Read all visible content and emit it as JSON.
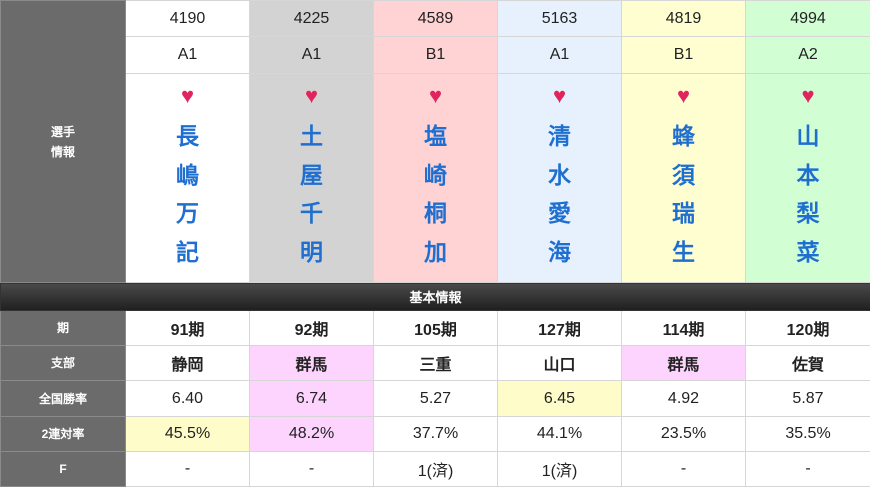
{
  "racers": [
    {
      "number": "4190",
      "grade": "A1",
      "name_chars": [
        "長",
        "嶋",
        "万",
        "記"
      ],
      "term": "91期",
      "branch": "静岡",
      "national_rate": "6.40",
      "quinella_rate": "45.5%",
      "f": "-"
    },
    {
      "number": "4225",
      "grade": "A1",
      "name_chars": [
        "土",
        "屋",
        "千",
        "明"
      ],
      "term": "92期",
      "branch": "群馬",
      "national_rate": "6.74",
      "quinella_rate": "48.2%",
      "f": "-"
    },
    {
      "number": "4589",
      "grade": "B1",
      "name_chars": [
        "塩",
        "崎",
        "桐",
        "加"
      ],
      "term": "105期",
      "branch": "三重",
      "national_rate": "5.27",
      "quinella_rate": "37.7%",
      "f": "1(済)"
    },
    {
      "number": "5163",
      "grade": "A1",
      "name_chars": [
        "清",
        "水",
        "愛",
        "海"
      ],
      "term": "127期",
      "branch": "山口",
      "national_rate": "6.45",
      "quinella_rate": "44.1%",
      "f": "1(済)"
    },
    {
      "number": "4819",
      "grade": "B1",
      "name_chars": [
        "蜂",
        "須",
        "瑞",
        "生"
      ],
      "term": "114期",
      "branch": "群馬",
      "national_rate": "4.92",
      "quinella_rate": "23.5%",
      "f": "-"
    },
    {
      "number": "4994",
      "grade": "A2",
      "name_chars": [
        "山",
        "本",
        "梨",
        "菜"
      ],
      "term": "120期",
      "branch": "佐賀",
      "national_rate": "5.87",
      "quinella_rate": "35.5%",
      "f": "-"
    }
  ],
  "labels": {
    "player_info": "選手\n情報",
    "section_basic": "基本情報",
    "term": "期",
    "branch": "支部",
    "national_rate": "全国勝率",
    "quinella_rate": "2連対率",
    "f": "F"
  },
  "heart_symbol": "♥",
  "lane_colors": [
    "#ffffff",
    "#d3d3d3",
    "#ffd2d4",
    "#e7f1fe",
    "#fffed0",
    "#d1ffd3"
  ],
  "highlight_colors": {
    "pink": "#fcd4fd",
    "yellow": "#fefdc9"
  }
}
